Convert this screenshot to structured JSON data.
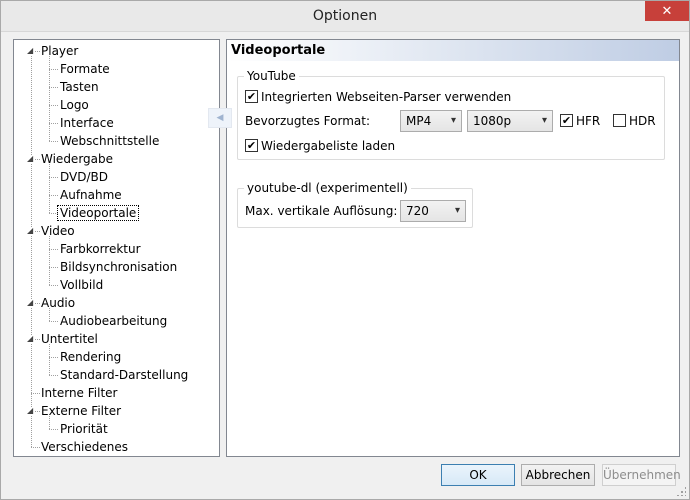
{
  "window": {
    "title": "Optionen",
    "close_icon": "close-icon"
  },
  "tree": [
    {
      "label": "Player",
      "level": 0,
      "expanded": true
    },
    {
      "label": "Formate",
      "level": 1
    },
    {
      "label": "Tasten",
      "level": 1
    },
    {
      "label": "Logo",
      "level": 1
    },
    {
      "label": "Interface",
      "level": 1
    },
    {
      "label": "Webschnittstelle",
      "level": 1
    },
    {
      "label": "Wiedergabe",
      "level": 0,
      "expanded": true
    },
    {
      "label": "DVD/BD",
      "level": 1
    },
    {
      "label": "Aufnahme",
      "level": 1
    },
    {
      "label": "Videoportale",
      "level": 1,
      "selected": true
    },
    {
      "label": "Video",
      "level": 0,
      "expanded": true
    },
    {
      "label": "Farbkorrektur",
      "level": 1
    },
    {
      "label": "Bildsynchronisation",
      "level": 1
    },
    {
      "label": "Vollbild",
      "level": 1
    },
    {
      "label": "Audio",
      "level": 0,
      "expanded": true
    },
    {
      "label": "Audiobearbeitung",
      "level": 1
    },
    {
      "label": "Untertitel",
      "level": 0,
      "expanded": true
    },
    {
      "label": "Rendering",
      "level": 1
    },
    {
      "label": "Standard-Darstellung",
      "level": 1
    },
    {
      "label": "Interne Filter",
      "level": 0
    },
    {
      "label": "Externe Filter",
      "level": 0,
      "expanded": true
    },
    {
      "label": "Priorität",
      "level": 1
    },
    {
      "label": "Verschiedenes",
      "level": 0
    }
  ],
  "panel": {
    "title": "Videoportale",
    "youtube": {
      "group_title": "YouTube",
      "parser_label": "Integrierten Webseiten-Parser verwenden",
      "parser_checked": true,
      "format_label": "Bevorzugtes Format:",
      "format_value": "MP4",
      "resolution_value": "1080p",
      "hfr_label": "HFR",
      "hfr_checked": true,
      "hdr_label": "HDR",
      "hdr_checked": false,
      "playlist_label": "Wiedergabeliste laden",
      "playlist_checked": true
    },
    "youtube_dl": {
      "group_title": "youtube-dl (experimentell)",
      "max_res_label": "Max. vertikale Auflösung:",
      "max_res_value": "720"
    }
  },
  "buttons": {
    "ok": "OK",
    "cancel": "Abbrechen",
    "apply": "Übernehmen"
  },
  "check_mark": "✔",
  "chevron": "▾",
  "expander_glyph": "◢"
}
